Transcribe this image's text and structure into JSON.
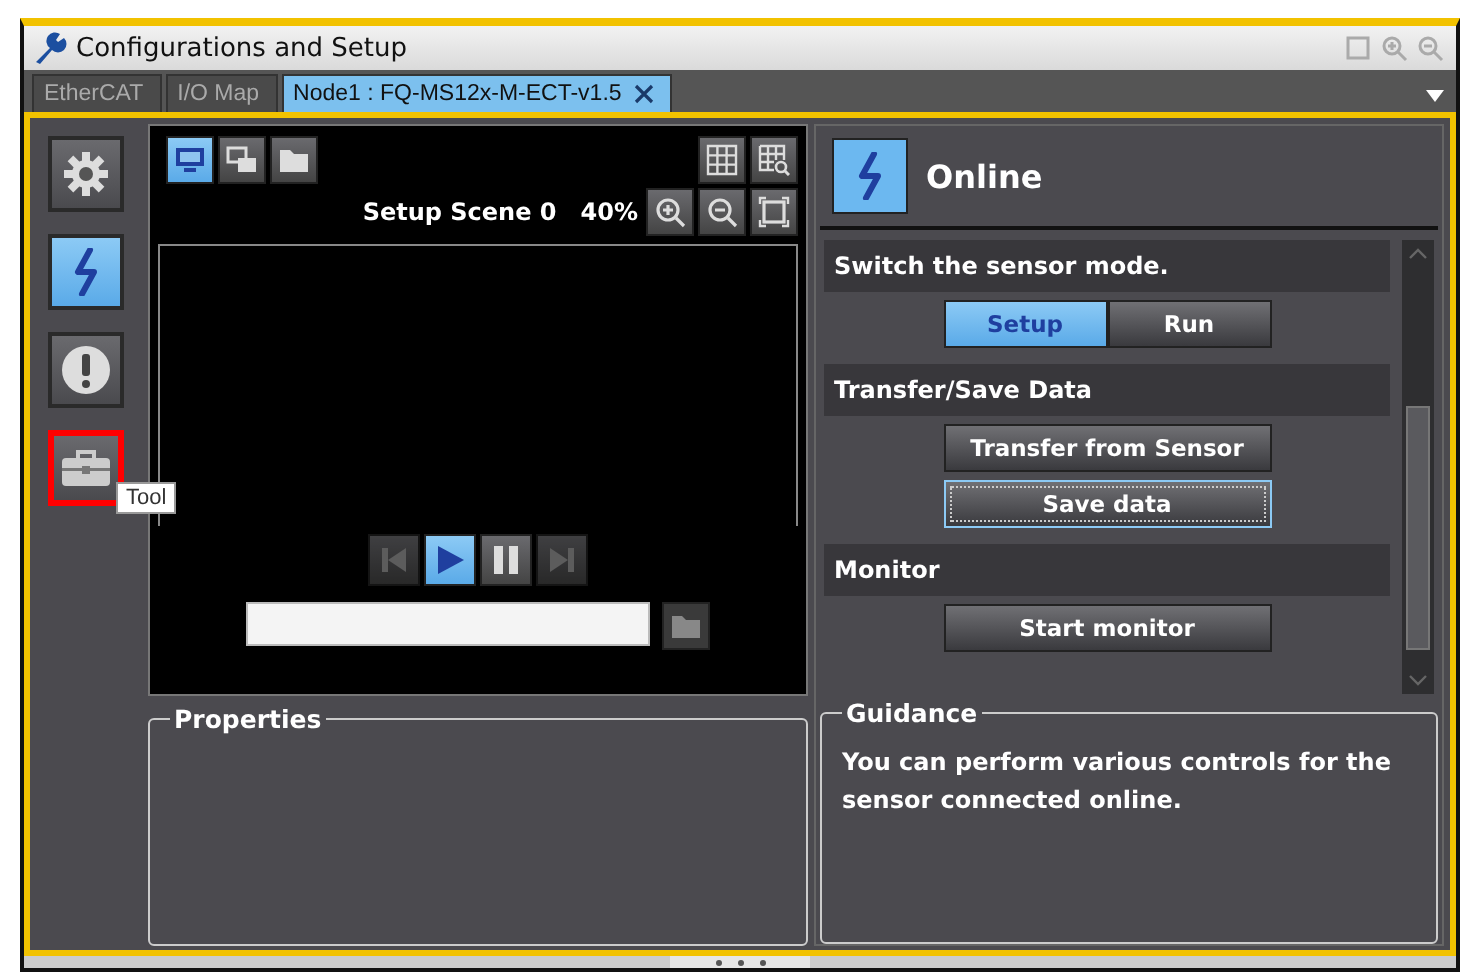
{
  "window": {
    "title": "Configurations and Setup"
  },
  "tabs": [
    {
      "label": "EtherCAT",
      "selected": false,
      "closable": false
    },
    {
      "label": "I/O Map",
      "selected": false,
      "closable": false
    },
    {
      "label": "Node1 : FQ-MS12x-M-ECT-v1.5",
      "selected": true,
      "closable": true
    }
  ],
  "sidebar": {
    "items": [
      {
        "kind": "gear",
        "selected": false,
        "highlighted": false
      },
      {
        "kind": "online",
        "selected": true,
        "highlighted": false
      },
      {
        "kind": "alert",
        "selected": false,
        "highlighted": false
      },
      {
        "kind": "toolbox",
        "selected": false,
        "highlighted": true
      }
    ],
    "tooltip": "Tool"
  },
  "viewer": {
    "view_buttons": [
      {
        "kind": "monitor",
        "selected": true
      },
      {
        "kind": "images",
        "selected": false
      },
      {
        "kind": "folder",
        "selected": false
      }
    ],
    "scene": "Setup Scene 0",
    "zoom": "40%",
    "playback": [
      {
        "kind": "first",
        "selected": false,
        "disabled": true
      },
      {
        "kind": "play",
        "selected": true,
        "disabled": false
      },
      {
        "kind": "pause",
        "selected": false,
        "disabled": false
      },
      {
        "kind": "last",
        "selected": false,
        "disabled": true
      }
    ]
  },
  "properties": {
    "legend": "Properties"
  },
  "panel": {
    "title": "Online",
    "sections": [
      {
        "heading": "Switch the sensor mode.",
        "kind": "toggle",
        "buttons": [
          {
            "label": "Setup",
            "selected": true
          },
          {
            "label": "Run",
            "selected": false
          }
        ]
      },
      {
        "heading": "Transfer/Save Data",
        "kind": "stack",
        "buttons": [
          {
            "label": "Transfer from Sensor",
            "selected": false
          },
          {
            "label": "Save data",
            "selected": true
          }
        ]
      },
      {
        "heading": "Monitor",
        "kind": "stack",
        "buttons": [
          {
            "label": "Start monitor",
            "selected": false
          }
        ]
      }
    ]
  },
  "guidance": {
    "legend": "Guidance",
    "text": "You can perform various controls for the sensor connected online."
  }
}
